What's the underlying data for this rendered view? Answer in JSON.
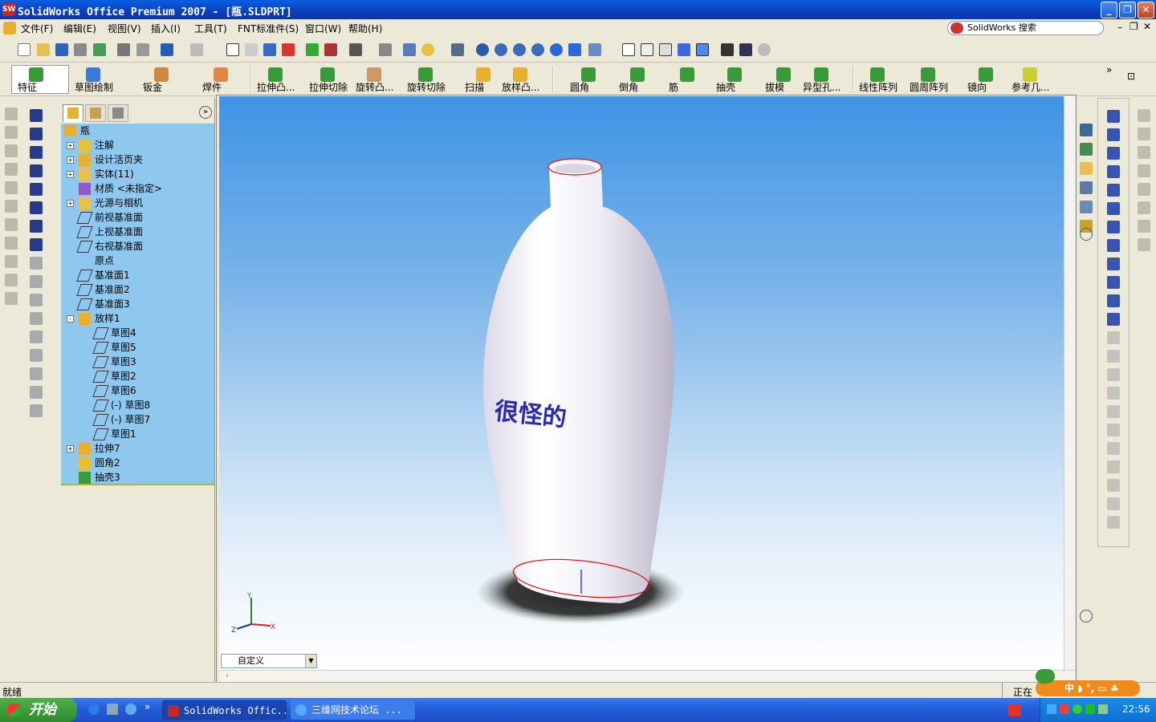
{
  "window": {
    "title": "SolidWorks Office Premium 2007 - [瓶.SLDPRT]",
    "app_icon": "solidworks-logo",
    "controls": [
      "minimize",
      "restore",
      "close"
    ]
  },
  "menu": {
    "items": [
      "文件(F)",
      "编辑(E)",
      "视图(V)",
      "插入(I)",
      "工具(T)",
      "FNT标准件(S)",
      "窗口(W)",
      "帮助(H)"
    ],
    "search_placeholder": "SolidWorks 搜索"
  },
  "command_manager": {
    "items": [
      {
        "label": "特征",
        "icon": "features-icon"
      },
      {
        "label": "草图绘制",
        "icon": "sketch-icon"
      },
      {
        "label": "钣金",
        "icon": "sheetmetal-icon"
      },
      {
        "label": "焊件",
        "icon": "weldment-icon"
      },
      {
        "label": "拉伸凸...",
        "icon": "extrude-boss-icon"
      },
      {
        "label": "拉伸切除",
        "icon": "extrude-cut-icon"
      },
      {
        "label": "旋转凸...",
        "icon": "revolve-boss-icon"
      },
      {
        "label": "旋转切除",
        "icon": "revolve-cut-icon"
      },
      {
        "label": "扫描",
        "icon": "sweep-icon"
      },
      {
        "label": "放样凸...",
        "icon": "loft-icon"
      },
      {
        "label": "圆角",
        "icon": "fillet-icon"
      },
      {
        "label": "倒角",
        "icon": "chamfer-icon"
      },
      {
        "label": "筋",
        "icon": "rib-icon"
      },
      {
        "label": "抽壳",
        "icon": "shell-icon"
      },
      {
        "label": "拔模",
        "icon": "draft-icon"
      },
      {
        "label": "异型孔...",
        "icon": "hole-wizard-icon"
      },
      {
        "label": "线性阵列",
        "icon": "linear-pattern-icon"
      },
      {
        "label": "圆周阵列",
        "icon": "circular-pattern-icon"
      },
      {
        "label": "镜向",
        "icon": "mirror-icon"
      },
      {
        "label": "参考几...",
        "icon": "reference-geometry-icon"
      }
    ]
  },
  "feature_tree": {
    "root": "瓶",
    "items": [
      {
        "label": "注解",
        "expander": "+",
        "indent": 0,
        "icon": "annotation-icon"
      },
      {
        "label": "设计活页夹",
        "expander": "+",
        "indent": 0,
        "icon": "design-binder-icon"
      },
      {
        "label": "实体(11)",
        "expander": "+",
        "indent": 0,
        "icon": "solid-bodies-icon"
      },
      {
        "label": "材质 <未指定>",
        "expander": "",
        "indent": 0,
        "icon": "material-icon"
      },
      {
        "label": "光源与相机",
        "expander": "+",
        "indent": 0,
        "icon": "lights-icon"
      },
      {
        "label": "前视基准面",
        "expander": "",
        "indent": 0,
        "icon": "plane-icon"
      },
      {
        "label": "上视基准面",
        "expander": "",
        "indent": 0,
        "icon": "plane-icon"
      },
      {
        "label": "右视基准面",
        "expander": "",
        "indent": 0,
        "icon": "plane-icon"
      },
      {
        "label": "原点",
        "expander": "",
        "indent": 0,
        "icon": "origin-icon"
      },
      {
        "label": "基准面1",
        "expander": "",
        "indent": 0,
        "icon": "plane-icon"
      },
      {
        "label": "基准面2",
        "expander": "",
        "indent": 0,
        "icon": "plane-icon"
      },
      {
        "label": "基准面3",
        "expander": "",
        "indent": 0,
        "icon": "plane-icon"
      },
      {
        "label": "放样1",
        "expander": "-",
        "indent": 0,
        "icon": "loft-icon"
      },
      {
        "label": "草图4",
        "expander": "",
        "indent": 1,
        "icon": "sketch-icon"
      },
      {
        "label": "草图5",
        "expander": "",
        "indent": 1,
        "icon": "sketch-icon"
      },
      {
        "label": "草图3",
        "expander": "",
        "indent": 1,
        "icon": "sketch-icon"
      },
      {
        "label": "草图2",
        "expander": "",
        "indent": 1,
        "icon": "sketch-icon"
      },
      {
        "label": "草图6",
        "expander": "",
        "indent": 1,
        "icon": "sketch-icon"
      },
      {
        "label": "(-) 草图8",
        "expander": "",
        "indent": 1,
        "icon": "sketch-icon"
      },
      {
        "label": "(-) 草图7",
        "expander": "",
        "indent": 1,
        "icon": "sketch-icon"
      },
      {
        "label": "草图1",
        "expander": "",
        "indent": 1,
        "icon": "sketch-icon"
      },
      {
        "label": "拉伸7",
        "expander": "+",
        "indent": 0,
        "icon": "extrude-icon"
      },
      {
        "label": "圆角2",
        "expander": "",
        "indent": 0,
        "icon": "fillet-icon"
      },
      {
        "label": "抽壳3",
        "expander": "",
        "indent": 0,
        "icon": "shell-icon"
      }
    ]
  },
  "viewport": {
    "model_text": "很怪的",
    "triad": {
      "x": "X",
      "y": "Y",
      "z": "Z"
    },
    "view_selector": "自定义",
    "colors": {
      "bottle": "#f2f0f7",
      "edge": "#e01010",
      "text": "#2a2ab0",
      "shadow": "#3a3a3a"
    }
  },
  "status": {
    "left": "就绪",
    "right": "正在"
  },
  "taskbar": {
    "start": "开始",
    "tasks": [
      "SolidWorks Offic...",
      "三维网技术论坛 ..."
    ],
    "clock": "22:56",
    "ime": "中"
  }
}
